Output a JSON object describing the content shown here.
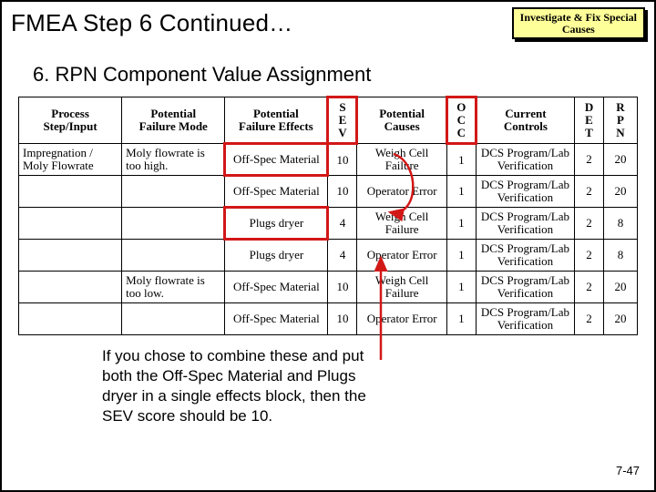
{
  "title": "FMEA Step 6 Continued…",
  "badge": {
    "line1": "Investigate & Fix Special",
    "line2": "Causes"
  },
  "subheading": "6.  RPN Component Value Assignment",
  "headers": {
    "process": "Process\nStep/Input",
    "mode": "Potential\nFailure Mode",
    "effects": "Potential\nFailure Effects",
    "sev": "S\nE\nV",
    "causes": "Potential\nCauses",
    "occ": "O\nC\nC",
    "controls": "Current\nControls",
    "det": "D\nE\nT",
    "rpn": "R\nP\nN"
  },
  "rows": [
    {
      "process": "Impregnation / Moly Flowrate",
      "mode": "Moly flowrate is too high.",
      "effects": "Off-Spec Material",
      "sev": "10",
      "causes": "Weigh Cell Failure",
      "occ": "1",
      "controls": "DCS Program/Lab Verification",
      "det": "2",
      "rpn": "20"
    },
    {
      "process": "",
      "mode": "",
      "effects": "Off-Spec Material",
      "sev": "10",
      "causes": "Operator Error",
      "occ": "1",
      "controls": "DCS Program/Lab Verification",
      "det": "2",
      "rpn": "20"
    },
    {
      "process": "",
      "mode": "",
      "effects": "Plugs dryer",
      "sev": "4",
      "causes": "Weigh Cell Failure",
      "occ": "1",
      "controls": "DCS Program/Lab Verification",
      "det": "2",
      "rpn": "8"
    },
    {
      "process": "",
      "mode": "",
      "effects": "Plugs dryer",
      "sev": "4",
      "causes": "Operator Error",
      "occ": "1",
      "controls": "DCS Program/Lab Verification",
      "det": "2",
      "rpn": "8"
    },
    {
      "process": "",
      "mode": "Moly flowrate is too low.",
      "effects": "Off-Spec Material",
      "sev": "10",
      "causes": "Weigh Cell Failure",
      "occ": "1",
      "controls": "DCS Program/Lab Verification",
      "det": "2",
      "rpn": "20"
    },
    {
      "process": "",
      "mode": "",
      "effects": "Off-Spec Material",
      "sev": "10",
      "causes": "Operator Error",
      "occ": "1",
      "controls": "DCS Program/Lab Verification",
      "det": "2",
      "rpn": "20"
    }
  ],
  "annotation": "If you chose to combine these and put both the Off-Spec Material and Plugs dryer in a single effects block, then the SEV score should be 10.",
  "pageNum": "7-47"
}
